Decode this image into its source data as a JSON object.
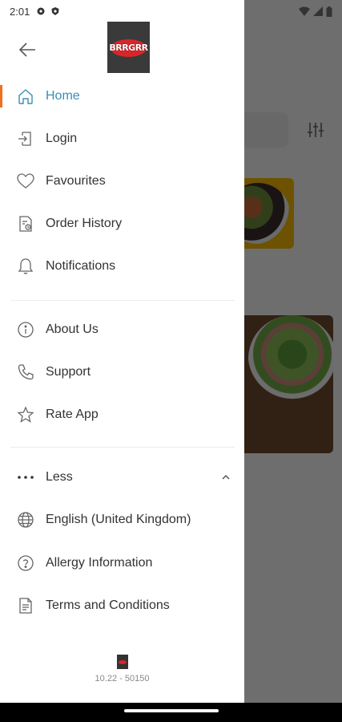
{
  "status_bar": {
    "time": "2:01"
  },
  "brand": {
    "logo_text": "BRRGRR",
    "accent": "#f0701e",
    "active_text": "#3b8fb0"
  },
  "menu": {
    "primary": [
      {
        "label": "Home",
        "icon": "home-icon",
        "active": true
      },
      {
        "label": "Login",
        "icon": "login-icon"
      },
      {
        "label": "Favourites",
        "icon": "heart-icon"
      },
      {
        "label": "Order History",
        "icon": "order-history-icon"
      },
      {
        "label": "Notifications",
        "icon": "bell-icon"
      }
    ],
    "secondary": [
      {
        "label": "About Us",
        "icon": "info-icon"
      },
      {
        "label": "Support",
        "icon": "phone-icon"
      },
      {
        "label": "Rate App",
        "icon": "star-icon"
      }
    ],
    "toggle": {
      "label": "Less",
      "icon": "more-dots-icon"
    },
    "extra": [
      {
        "label": "English (United Kingdom)",
        "icon": "globe-icon"
      },
      {
        "label": "Allergy Information",
        "icon": "help-circle-icon"
      },
      {
        "label": "Terms and Conditions",
        "icon": "document-icon"
      }
    ]
  },
  "footer": {
    "version": "10.22 - 50150"
  }
}
